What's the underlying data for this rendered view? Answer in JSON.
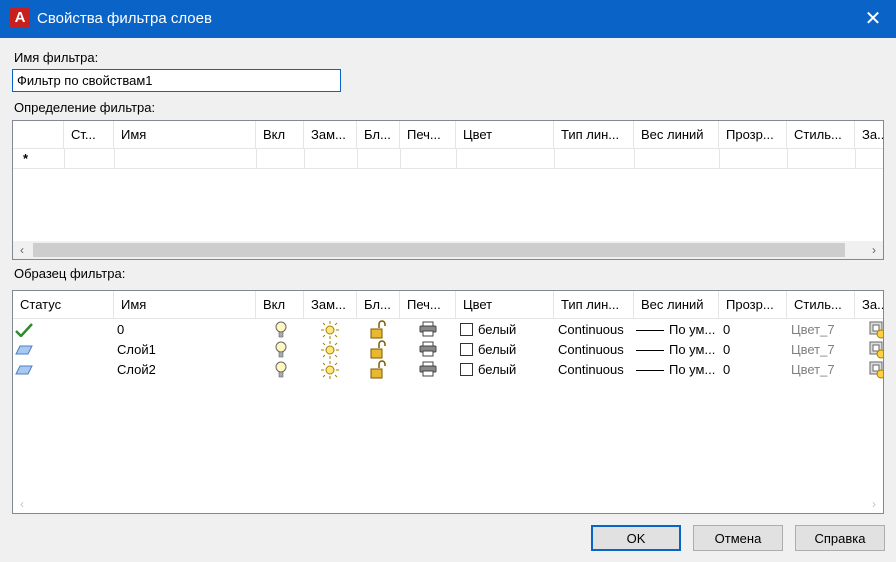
{
  "window": {
    "title": "Свойства фильтра слоев",
    "close_glyph": "✕",
    "app_icon": "A"
  },
  "name_label": "Имя фильтра:",
  "name_value": "Фильтр по свойствам1",
  "definition_label": "Определение фильтра:",
  "definition_columns": [
    "Ст...",
    "Имя",
    "Вкл",
    "Зам...",
    "Бл...",
    "Печ...",
    "Цвет",
    "Тип лин...",
    "Вес линий",
    "Прозр...",
    "Стиль...",
    "За..."
  ],
  "definition_new_row_marker": "*",
  "preview_label": "Образец фильтра:",
  "preview_columns": [
    "Статус",
    "Имя",
    "Вкл",
    "Зам...",
    "Бл...",
    "Печ...",
    "Цвет",
    "Тип лин...",
    "Вес линий",
    "Прозр...",
    "Стиль...",
    "За..."
  ],
  "layers": [
    {
      "status_icon": "check-icon",
      "name": "0",
      "color": "белый",
      "linetype": "Continuous",
      "lineweight": "По ум...",
      "transparency": "0",
      "plot_style": "Цвет_7"
    },
    {
      "status_icon": "layer-icon",
      "name": "Слой1",
      "color": "белый",
      "linetype": "Continuous",
      "lineweight": "По ум...",
      "transparency": "0",
      "plot_style": "Цвет_7"
    },
    {
      "status_icon": "layer-icon",
      "name": "Слой2",
      "color": "белый",
      "linetype": "Continuous",
      "lineweight": "По ум...",
      "transparency": "0",
      "plot_style": "Цвет_7"
    }
  ],
  "buttons": {
    "ok": "OK",
    "cancel": "Отмена",
    "help": "Справка"
  },
  "colors": {
    "titlebar": "#0a64c8",
    "check": "#2e8b2e",
    "layer": "#4a80c8"
  }
}
